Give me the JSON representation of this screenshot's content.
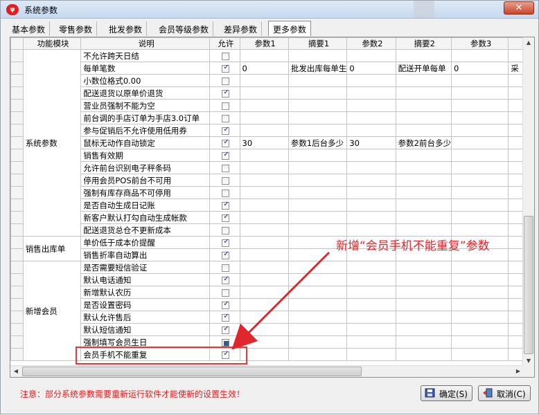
{
  "window": {
    "title": "系统参数",
    "close_label": "✕"
  },
  "tabs": [
    "基本参数",
    "零售参数",
    "批发参数",
    "会员等级参数",
    "差异参数",
    "更多参数"
  ],
  "columns": [
    "功能模块",
    "说明",
    "允许",
    "参数1",
    "摘要1",
    "参数2",
    "摘要2",
    "参数3"
  ],
  "groups": {
    "system": "系统参数",
    "sales_out": "销售出库单",
    "new_member": "新增会员"
  },
  "rows": [
    {
      "desc": "不允许跨天日结",
      "allow": "unchecked",
      "p1": "",
      "s1": "",
      "p2": "",
      "s2": "",
      "p3": ""
    },
    {
      "desc": "每单笔数",
      "allow": "checked",
      "p1": "0",
      "s1": "批发出库每单生",
      "p2": "0",
      "s2": "配送开单每单",
      "p3": "0",
      "extra": "采"
    },
    {
      "desc": "小数位格式0.00",
      "allow": "unchecked",
      "p1": "",
      "s1": "",
      "p2": "",
      "s2": "",
      "p3": ""
    },
    {
      "desc": "配送退货以原单价退货",
      "allow": "checked",
      "p1": "",
      "s1": "",
      "p2": "",
      "s2": "",
      "p3": ""
    },
    {
      "desc": "营业员强制不能为空",
      "allow": "unchecked",
      "p1": "",
      "s1": "",
      "p2": "",
      "s2": "",
      "p3": ""
    },
    {
      "desc": "前台调的手店订单为手店3.0订单",
      "allow": "unchecked",
      "p1": "",
      "s1": "",
      "p2": "",
      "s2": "",
      "p3": ""
    },
    {
      "desc": "参与促销后不允许使用低用券",
      "allow": "checked",
      "p1": "",
      "s1": "",
      "p2": "",
      "s2": "",
      "p3": ""
    },
    {
      "desc": "鼠标无动作自动锁定",
      "allow": "checked",
      "p1": "30",
      "s1": "参数1后台多少",
      "p2": "30",
      "s2": "参数2前台多少",
      "p3": ""
    },
    {
      "desc": "销售有效期",
      "allow": "checked",
      "p1": "",
      "s1": "",
      "p2": "",
      "s2": "",
      "p3": ""
    },
    {
      "desc": "允许前台识别电子秤条码",
      "allow": "unchecked",
      "p1": "",
      "s1": "",
      "p2": "",
      "s2": "",
      "p3": ""
    },
    {
      "desc": "停用会员POS前台不可用",
      "allow": "unchecked",
      "p1": "",
      "s1": "",
      "p2": "",
      "s2": "",
      "p3": ""
    },
    {
      "desc": "强制有库存商品不可停用",
      "allow": "unchecked",
      "p1": "",
      "s1": "",
      "p2": "",
      "s2": "",
      "p3": ""
    },
    {
      "desc": "是否自动生成日记账",
      "allow": "checked",
      "p1": "",
      "s1": "",
      "p2": "",
      "s2": "",
      "p3": ""
    },
    {
      "desc": "新客户默认打勾自动生成帐款",
      "allow": "checked",
      "p1": "",
      "s1": "",
      "p2": "",
      "s2": "",
      "p3": ""
    },
    {
      "desc": "配送退货总仓不更新成本",
      "allow": "unchecked",
      "p1": "",
      "s1": "",
      "p2": "",
      "s2": "",
      "p3": ""
    },
    {
      "desc": "单价低于成本价提醒",
      "allow": "checked",
      "p1": "",
      "s1": "",
      "p2": "",
      "s2": "",
      "p3": ""
    },
    {
      "desc": "销售折率自动算出",
      "allow": "checked",
      "p1": "",
      "s1": "",
      "p2": "",
      "s2": "",
      "p3": ""
    },
    {
      "desc": "是否需要短信验证",
      "allow": "unchecked",
      "p1": "",
      "s1": "",
      "p2": "",
      "s2": "",
      "p3": ""
    },
    {
      "desc": "默认电话通知",
      "allow": "checked",
      "p1": "",
      "s1": "",
      "p2": "",
      "s2": "",
      "p3": ""
    },
    {
      "desc": "新增默认农历",
      "allow": "unchecked",
      "p1": "",
      "s1": "",
      "p2": "",
      "s2": "",
      "p3": ""
    },
    {
      "desc": "是否设置密码",
      "allow": "checked",
      "p1": "",
      "s1": "",
      "p2": "",
      "s2": "",
      "p3": ""
    },
    {
      "desc": "默认允许售后",
      "allow": "checked",
      "p1": "",
      "s1": "",
      "p2": "",
      "s2": "",
      "p3": ""
    },
    {
      "desc": "默认短信通知",
      "allow": "checked",
      "p1": "",
      "s1": "",
      "p2": "",
      "s2": "",
      "p3": ""
    },
    {
      "desc": "强制填写会员生日",
      "allow": "partial",
      "p1": "",
      "s1": "",
      "p2": "",
      "s2": "",
      "p3": ""
    },
    {
      "desc": "会员手机不能重复",
      "allow": "checked",
      "p1": "",
      "s1": "",
      "p2": "",
      "s2": "",
      "p3": ""
    }
  ],
  "annotation": "新增“会员手机不能重复”参数",
  "footer": {
    "note": "注意：部分系统参数需要重新运行软件才能使新的设置生效！",
    "ok_label": "确定(S)",
    "cancel_label": "取消(C)"
  },
  "colors": {
    "annotation": "#e0282c",
    "note": "#e02020"
  },
  "icons": {
    "app": "app-logo-icon",
    "ok": "save-icon",
    "cancel": "exit-icon"
  }
}
